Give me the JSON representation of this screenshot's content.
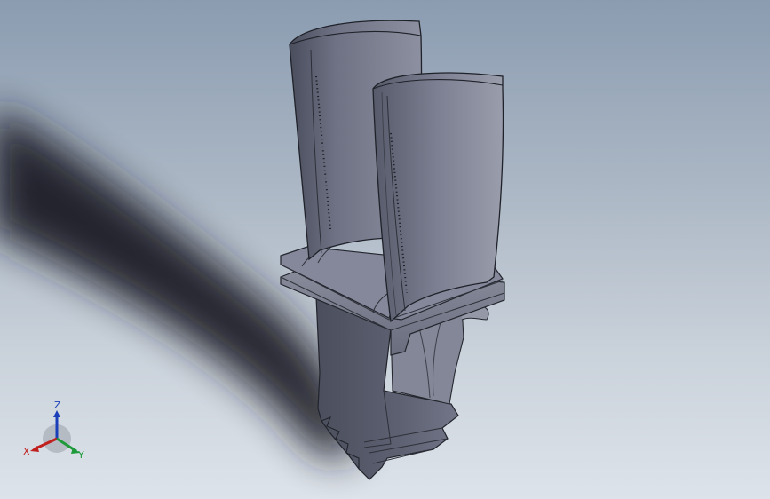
{
  "viewport": {
    "model": "turbine-blade",
    "background_top": "#8b9cb1",
    "background_bottom": "#dde3ea"
  },
  "triad": {
    "x_label": "X",
    "y_label": "Y",
    "z_label": "Z",
    "x_color": "#c0201e",
    "y_color": "#1e9a3a",
    "z_color": "#1a3fb8"
  },
  "icons": [
    "reference-triad-icon"
  ]
}
